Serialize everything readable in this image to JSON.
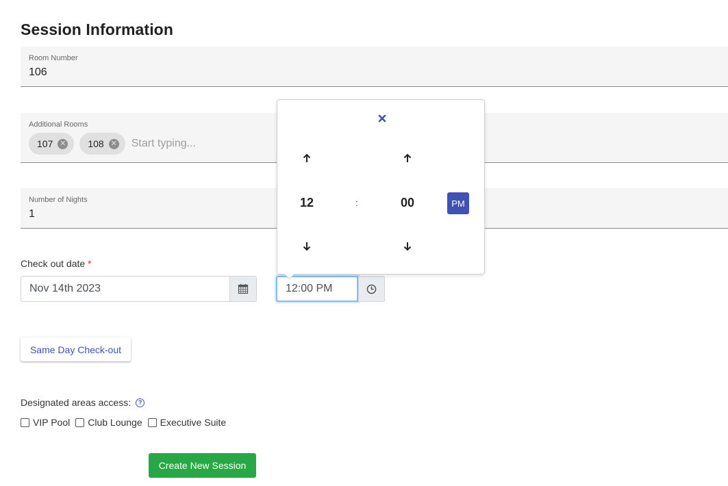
{
  "page_title": "Session Information",
  "room_number": {
    "label": "Room Number",
    "value": "106"
  },
  "additional_rooms": {
    "label": "Additional Rooms",
    "chips": [
      "107",
      "108"
    ],
    "placeholder": "Start typing..."
  },
  "number_of_nights": {
    "label": "Number of Nights",
    "value": "1"
  },
  "checkout": {
    "label": "Check out date",
    "required_mark": "*",
    "date_value": "Nov 14th 2023",
    "time_value": "12:00 PM"
  },
  "time_picker": {
    "hour": "12",
    "separator": ":",
    "minute": "00",
    "period": "PM"
  },
  "same_day_button": "Same Day Check-out",
  "designated_areas": {
    "label": "Designated areas access:",
    "help_symbol": "?",
    "options": [
      "VIP Pool",
      "Club Lounge",
      "Executive Suite"
    ]
  },
  "create_button": "Create New Session",
  "colors": {
    "accent": "#3f51b5",
    "create": "#28a745",
    "required": "#d32f2f"
  }
}
